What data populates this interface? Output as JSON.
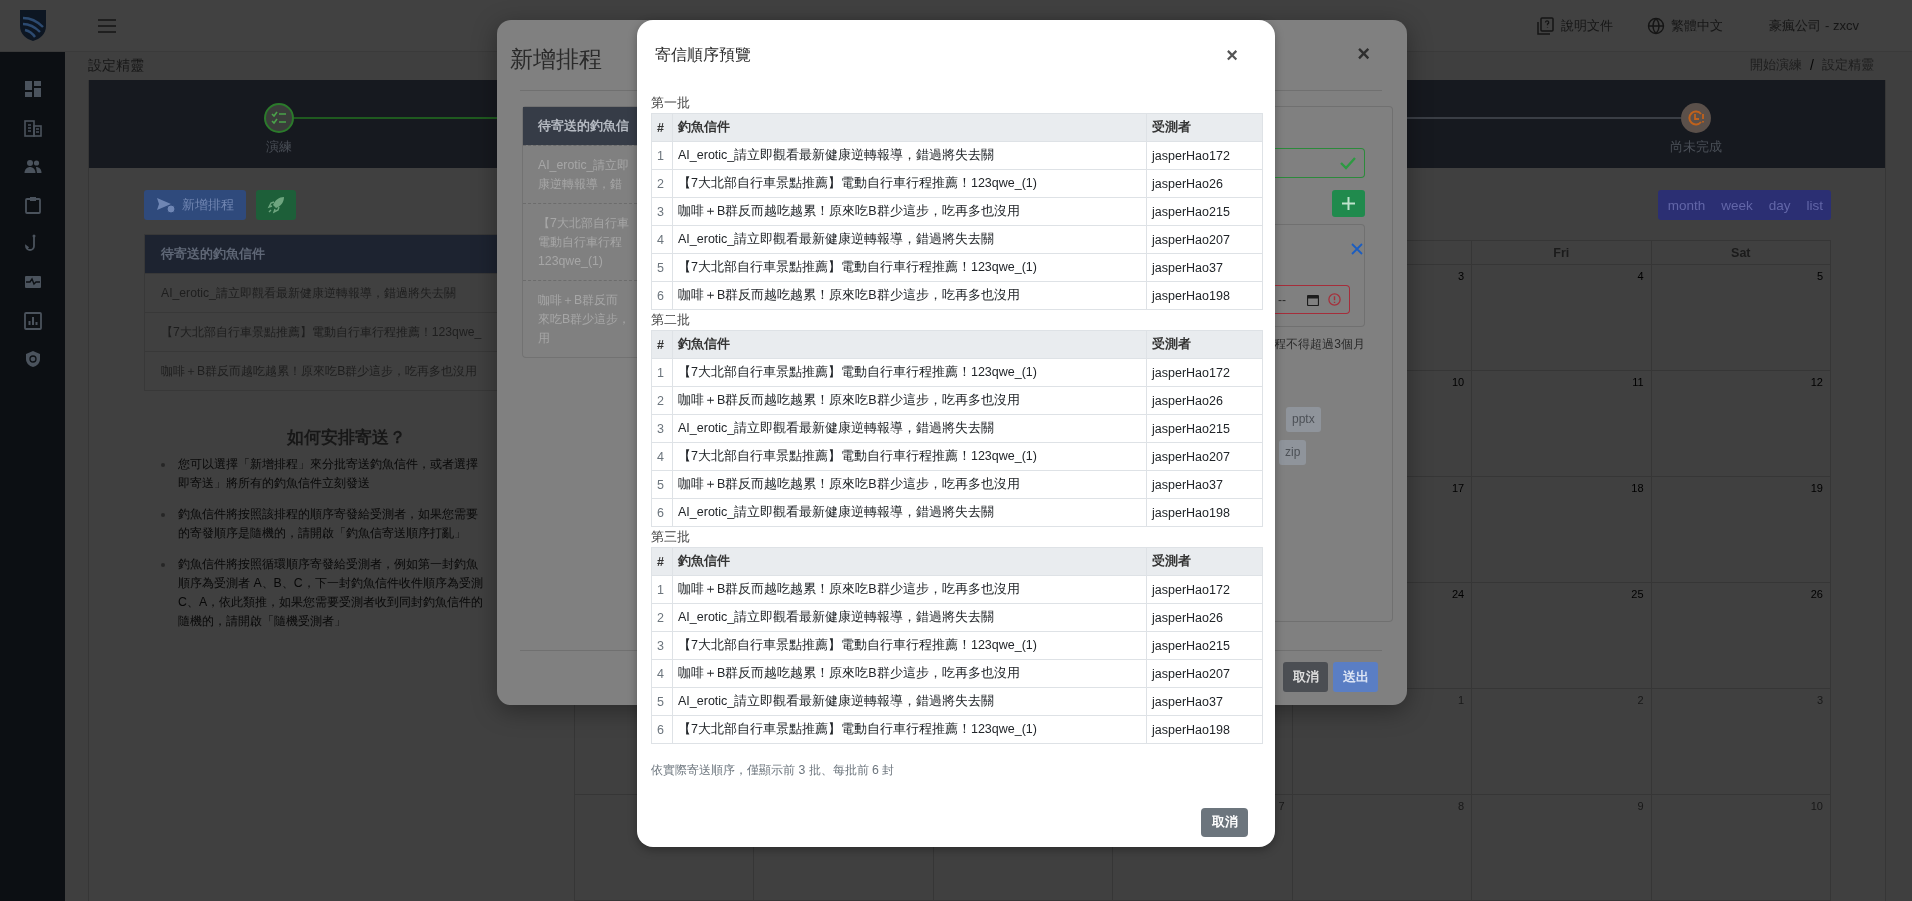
{
  "header": {
    "links": [
      "說明文件",
      "繁體中文"
    ],
    "account": "豪瘋公司 - zxcv"
  },
  "page": {
    "title": "設定精靈",
    "breadcrumb": [
      "開始演練",
      "設定精靈"
    ],
    "breadcrumb_separator": "/"
  },
  "stepper": {
    "steps": [
      {
        "label": "演練",
        "done": true
      },
      {
        "label": "尚未完成",
        "done": false
      }
    ]
  },
  "toolbar": {
    "add_schedule": "新增排程"
  },
  "pending_mails": {
    "title": "待寄送的釣魚信件",
    "items": [
      "AI_erotic_請立即觀看最新健康逆轉報導，錯過將失去關",
      "【7大北部自行車景點推薦】電動自行車行程推薦！123qwe_",
      "咖啡＋B群反而越吃越累！原來吃B群少這步，吃再多也沒用"
    ]
  },
  "guide": {
    "title": "如何安排寄送？",
    "items": [
      {
        "lines": [
          "您可以選擇「新增排程」來分批寄送釣魚信件，或者選擇",
          "即寄送」將所有的釣魚信件立刻發送"
        ]
      },
      {
        "lines": [
          "釣魚信件將按照該排程的順序寄發給受測者，如果您需要",
          "的寄發順序是隨機的，請開啟「釣魚信寄送順序打亂」"
        ]
      },
      {
        "lines": [
          "釣魚信件將按照循環順序寄發給受測者，例如第一封釣魚",
          "順序為受測者 A、B、C，下一封釣魚信件收件順序為受測",
          "C、A，依此類推，如果您需要受測者收到同封釣魚信件的",
          "隨機的，請開啟「隨機受測者」"
        ]
      }
    ]
  },
  "calendar": {
    "views": [
      "month",
      "week",
      "day",
      "list"
    ],
    "weekdays": [
      "Fri",
      "Sat"
    ],
    "weeks": [
      [
        {
          "day": "3",
          "other_month": false
        },
        {
          "day": "4",
          "other_month": false
        },
        {
          "day": "5",
          "other_month": false
        }
      ],
      [
        {
          "day": "10",
          "other_month": false
        },
        {
          "day": "11",
          "other_month": false
        },
        {
          "day": "12",
          "other_month": false
        }
      ],
      [
        {
          "day": "17",
          "other_month": false
        },
        {
          "day": "18",
          "other_month": false
        },
        {
          "day": "19",
          "other_month": false
        }
      ],
      [
        {
          "day": "24",
          "other_month": false
        },
        {
          "day": "25",
          "other_month": false
        },
        {
          "day": "26",
          "other_month": false
        }
      ],
      [
        {
          "day": "1",
          "other_month": true
        },
        {
          "day": "2",
          "other_month": true
        },
        {
          "day": "3",
          "other_month": true
        }
      ],
      [
        {
          "day": "7",
          "other_month": true
        },
        {
          "day": "8",
          "other_month": true
        },
        {
          "day": "9",
          "other_month": true
        },
        {
          "day": "10",
          "other_month": true
        }
      ]
    ]
  },
  "schedule_modal": {
    "title": "新增排程",
    "close": "×",
    "card_title": "待寄送的釣魚信",
    "items": [
      {
        "lines": [
          "AI_erotic_請立即",
          "康逆轉報導，錯"
        ]
      },
      {
        "lines": [
          "【7大北部自行車",
          "電動自行車行程",
          "123qwe_(1)"
        ]
      },
      {
        "lines": [
          "咖啡＋B群反而",
          "來吃B群少這步，",
          "用"
        ]
      }
    ],
    "name_field": {
      "valid": true
    },
    "date_field": {
      "value": "--",
      "valid": false
    },
    "hint": "程不得超過3個月",
    "tags": [
      "pptx",
      "zip"
    ],
    "buttons": [
      "取消",
      "送出"
    ]
  },
  "preview_modal": {
    "title": "寄信順序預覽",
    "close": "×",
    "batches": [
      {
        "title": "第一批",
        "columns": [
          "#",
          "釣魚信件",
          "受測者"
        ],
        "rows": [
          [
            "1",
            "AI_erotic_請立即觀看最新健康逆轉報導，錯過將失去關",
            "jasperHao172"
          ],
          [
            "2",
            "【7大北部自行車景點推薦】電動自行車行程推薦！123qwe_(1)",
            "jasperHao26"
          ],
          [
            "3",
            "咖啡＋B群反而越吃越累！原來吃B群少這步，吃再多也沒用",
            "jasperHao215"
          ],
          [
            "4",
            "AI_erotic_請立即觀看最新健康逆轉報導，錯過將失去關",
            "jasperHao207"
          ],
          [
            "5",
            "【7大北部自行車景點推薦】電動自行車行程推薦！123qwe_(1)",
            "jasperHao37"
          ],
          [
            "6",
            "咖啡＋B群反而越吃越累！原來吃B群少這步，吃再多也沒用",
            "jasperHao198"
          ]
        ]
      },
      {
        "title": "第二批",
        "columns": [
          "#",
          "釣魚信件",
          "受測者"
        ],
        "rows": [
          [
            "1",
            "【7大北部自行車景點推薦】電動自行車行程推薦！123qwe_(1)",
            "jasperHao172"
          ],
          [
            "2",
            "咖啡＋B群反而越吃越累！原來吃B群少這步，吃再多也沒用",
            "jasperHao26"
          ],
          [
            "3",
            "AI_erotic_請立即觀看最新健康逆轉報導，錯過將失去關",
            "jasperHao215"
          ],
          [
            "4",
            "【7大北部自行車景點推薦】電動自行車行程推薦！123qwe_(1)",
            "jasperHao207"
          ],
          [
            "5",
            "咖啡＋B群反而越吃越累！原來吃B群少這步，吃再多也沒用",
            "jasperHao37"
          ],
          [
            "6",
            "AI_erotic_請立即觀看最新健康逆轉報導，錯過將失去關",
            "jasperHao198"
          ]
        ]
      },
      {
        "title": "第三批",
        "columns": [
          "#",
          "釣魚信件",
          "受測者"
        ],
        "rows": [
          [
            "1",
            "咖啡＋B群反而越吃越累！原來吃B群少這步，吃再多也沒用",
            "jasperHao172"
          ],
          [
            "2",
            "AI_erotic_請立即觀看最新健康逆轉報導，錯過將失去關",
            "jasperHao26"
          ],
          [
            "3",
            "【7大北部自行車景點推薦】電動自行車行程推薦！123qwe_(1)",
            "jasperHao215"
          ],
          [
            "4",
            "咖啡＋B群反而越吃越累！原來吃B群少這步，吃再多也沒用",
            "jasperHao207"
          ],
          [
            "5",
            "AI_erotic_請立即觀看最新健康逆轉報導，錯過將失去關",
            "jasperHao37"
          ],
          [
            "6",
            "【7大北部自行車景點推薦】電動自行車行程推薦！123qwe_(1)",
            "jasperHao198"
          ]
        ]
      }
    ],
    "note": "依實際寄送順序，僅顯示前 3 批、每批前 6 封",
    "cancel": "取消"
  }
}
